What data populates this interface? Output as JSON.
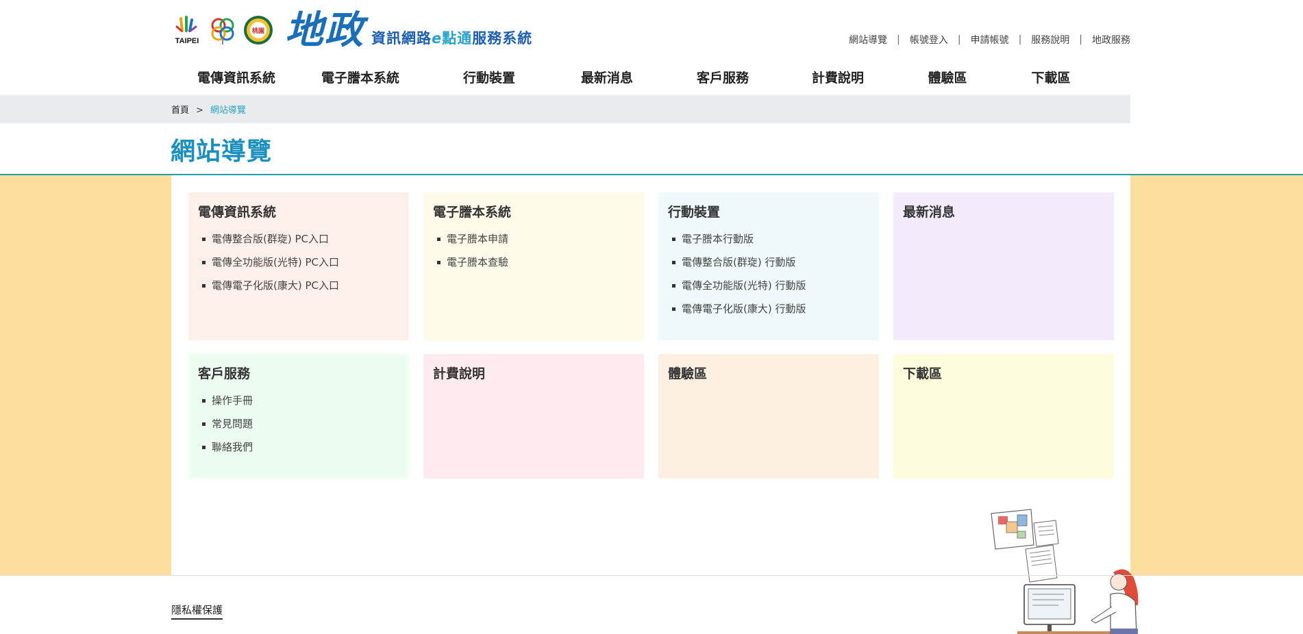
{
  "header": {
    "logos": [
      {
        "name": "taipei-logo",
        "text": "TAIPEI"
      },
      {
        "name": "city-logo",
        "text": ""
      },
      {
        "name": "taoyuan-logo",
        "text": "桃園"
      }
    ],
    "brand_main": "地政",
    "brand_sub_1": "資訊網路",
    "brand_sub_e": "e",
    "brand_sub_2": "點通",
    "brand_sub_3": "服務系統",
    "top_links": [
      "網站導覽",
      "帳號登入",
      "申請帳號",
      "服務說明",
      "地政服務"
    ]
  },
  "nav": [
    "電傳資訊系統",
    "電子謄本系統",
    "行動裝置",
    "最新消息",
    "客戶服務",
    "計費說明",
    "體驗區",
    "下載區"
  ],
  "breadcrumb": {
    "home": "首頁",
    "sep": ">",
    "current": "網站導覽"
  },
  "page_title": "網站導覽",
  "cards": [
    {
      "title": "電傳資訊系統",
      "color": "#fdf0ea",
      "items": [
        "電傳整合版(群琁) PC入口",
        "電傳全功能版(光特) PC入口",
        "電傳電子化版(康大) PC入口"
      ]
    },
    {
      "title": "電子謄本系統",
      "color": "#fefbea",
      "items": [
        "電子謄本申請",
        "電子謄本查驗"
      ]
    },
    {
      "title": "行動裝置",
      "color": "#f0fafd",
      "items": [
        "電子謄本行動版",
        "電傳整合版(群琁) 行動版",
        "電傳全功能版(光特) 行動版",
        "電傳電子化版(康大) 行動版"
      ]
    },
    {
      "title": "最新消息",
      "color": "#f4ecfd",
      "items": []
    },
    {
      "title": "客戶服務",
      "color": "#eefdf1",
      "items": [
        "操作手冊",
        "常見問題",
        "聯絡我們"
      ]
    },
    {
      "title": "計費說明",
      "color": "#fdebf0",
      "items": []
    },
    {
      "title": "體驗區",
      "color": "#fdf0e3",
      "items": []
    },
    {
      "title": "下載區",
      "color": "#fdfcdc",
      "items": []
    }
  ],
  "footer": {
    "privacy": "隱私權保護"
  },
  "colors": {
    "accent": "#1b8fbe",
    "side_band": "#fde0a0",
    "crumb_bg": "#e9ebee"
  }
}
